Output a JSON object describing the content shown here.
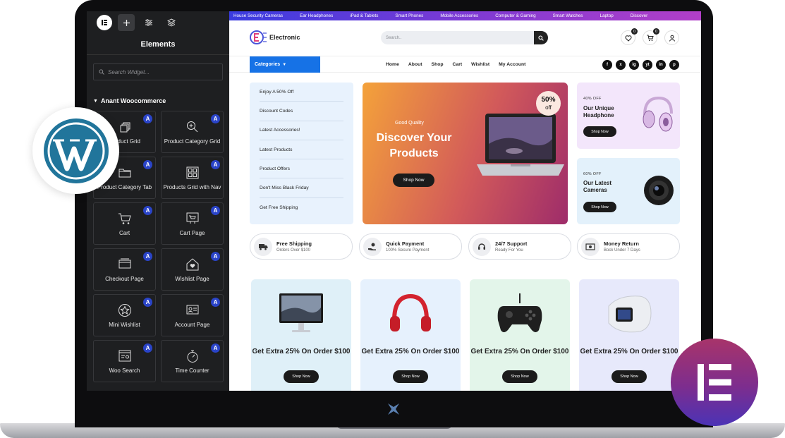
{
  "editor": {
    "title": "Elements",
    "search_placeholder": "Search Widget...",
    "section": "Anant Woocommerce",
    "widgets": [
      {
        "label": "Product Grid",
        "badge": "A",
        "icon": "cube-grid-icon"
      },
      {
        "label": "Product Category Grid",
        "badge": "A",
        "icon": "search-plus-icon"
      },
      {
        "label": "Product Category Tab",
        "badge": "A",
        "icon": "folder-tab-icon"
      },
      {
        "label": "Products Grid with Nav",
        "badge": "A",
        "icon": "grid-nav-icon"
      },
      {
        "label": "Cart",
        "badge": "A",
        "icon": "cart-icon"
      },
      {
        "label": "Cart Page",
        "badge": "A",
        "icon": "cart-page-icon"
      },
      {
        "label": "Checkout Page",
        "badge": "A",
        "icon": "checkout-icon"
      },
      {
        "label": "Wishlist Page",
        "badge": "A",
        "icon": "wishlist-icon"
      },
      {
        "label": "Mini Wishlist",
        "badge": "A",
        "icon": "star-icon"
      },
      {
        "label": "Account Page",
        "badge": "A",
        "icon": "account-icon"
      },
      {
        "label": "Woo Search",
        "badge": "A",
        "icon": "woo-search-icon"
      },
      {
        "label": "Time Counter",
        "badge": "A",
        "icon": "timer-icon"
      }
    ]
  },
  "site": {
    "topbar": [
      "House Security Cameras",
      "Ear Headphones",
      "iPad & Tablets",
      "Smart Phones",
      "Mobile Accessories",
      "Computer & Gaming",
      "Smart Watches",
      "Laptop",
      "Discover"
    ],
    "brand": "Electronic",
    "search_placeholder": "Search..",
    "wishlist_count": "0",
    "cart_count": "0",
    "categories_label": "Categories",
    "menu": [
      "Home",
      "About",
      "Shop",
      "Cart",
      "Wishlist",
      "My Account"
    ],
    "social": [
      "f",
      "x",
      "ig",
      "yt",
      "in",
      "p"
    ],
    "category_list": [
      "Enjoy A 50% Off",
      "Discount Codes",
      "Latest Accessories!",
      "Latest Products",
      "Product Offers",
      "Don't Miss Black Friday",
      "Get Free Shipping"
    ],
    "hero": {
      "kicker": "Good Quality",
      "title": "Discover Your Products",
      "button": "Shop Now",
      "badge_pct": "50%",
      "badge_off": "off"
    },
    "promos": [
      {
        "tag": "40% OFF",
        "title": "Our Unique Headphone",
        "button": "Shop Now"
      },
      {
        "tag": "60% OFF",
        "title": "Our Latest Cameras",
        "button": "Shop Now"
      }
    ],
    "features": [
      {
        "title": "Free Shipping",
        "sub": "Orders Over $100",
        "icon": "truck-icon"
      },
      {
        "title": "Quick Payment",
        "sub": "100% Secure Payment",
        "icon": "payment-hand-icon"
      },
      {
        "title": "24/7 Support",
        "sub": "Ready For You",
        "icon": "headset-icon"
      },
      {
        "title": "Money Return",
        "sub": "Bock Under 7 Days",
        "icon": "money-icon"
      }
    ],
    "cards": [
      {
        "title": "Get Extra 25% On Order $100",
        "button": "Shop Now",
        "icon": "monitor-icon",
        "bg": "#dff0f8"
      },
      {
        "title": "Get Extra 25% On Order $100",
        "button": "Shop Now",
        "icon": "headphones-icon",
        "bg": "#e6f1fd"
      },
      {
        "title": "Get Extra 25% On Order $100",
        "button": "Shop Now",
        "icon": "gamepad-icon",
        "bg": "#e3f5ea"
      },
      {
        "title": "Get Extra 25% On Order $100",
        "button": "Shop Now",
        "icon": "smartwatch-icon",
        "bg": "#e7e9fb"
      }
    ]
  },
  "colors": {
    "accent": "#1672e6",
    "badge": "#2a44c8",
    "editor_bg": "#1e1f21"
  }
}
